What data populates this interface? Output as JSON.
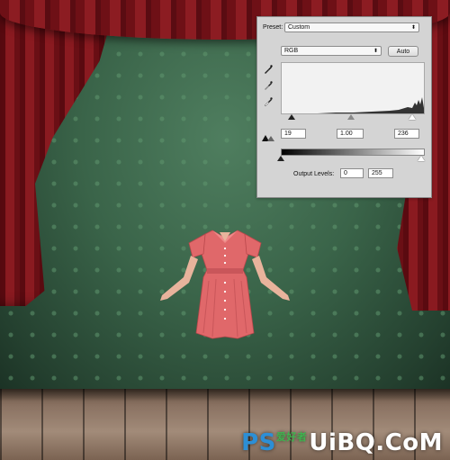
{
  "watermark": {
    "prefix": "PS",
    "decoration": "爱好者",
    "site": "UiBQ.CoM"
  },
  "levels_panel": {
    "preset_label": "Preset:",
    "preset_value": "Custom",
    "channel_value": "RGB",
    "auto_label": "Auto",
    "tools": [
      "black-eyedropper-icon",
      "gray-eyedropper-icon",
      "white-eyedropper-icon",
      "clipping-warning-icon"
    ],
    "input_levels": {
      "black": "19",
      "gamma": "1.00",
      "white": "236"
    },
    "output_levels_label": "Output Levels:",
    "output_levels": {
      "black": "0",
      "white": "255"
    }
  },
  "colors": {
    "curtain": "#7a141a",
    "backdrop": "#3a6449",
    "floor": "#8b7363",
    "dress": "#e0686a",
    "panel_bg": "#d4d4d4"
  }
}
